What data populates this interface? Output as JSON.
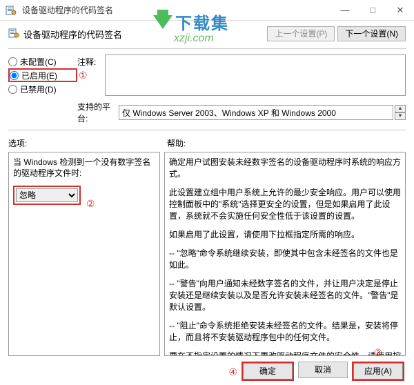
{
  "window": {
    "title": "设备驱动程序的代码签名",
    "minimize": "—",
    "maximize": "□",
    "close": "✕"
  },
  "header": {
    "main_label": "设备驱动程序的代码签名",
    "prev_btn": "上一个设置(P)",
    "next_btn": "下一个设置(N)"
  },
  "radios": {
    "not_configured": "未配置(C)",
    "enabled": "已启用(E)",
    "disabled": "已禁用(D)"
  },
  "labels": {
    "comment": "注释:",
    "platform": "支持的平台:",
    "options": "选项:",
    "help": "帮助:"
  },
  "platform_value": "仅 Windows Server 2003、Windows XP 和 Windows 2000",
  "left_pane": {
    "msg": "当 Windows 检测到一个没有数字签名的驱动程序文件时:",
    "select_value": "忽略"
  },
  "help_text": {
    "p1": "确定用户试图安装未经数字签名的设备驱动程序时系统的响应方式。",
    "p2": "此设置建立组中用户系统上允许的最少安全响应。用户可以使用控制面板中的\"系统\"选择更安全的设置，但是如果启用了此设置，系统就不会实施任何安全性低于该设置的设置。",
    "p3": "如果启用了此设置，请使用下拉框指定所需的响应。",
    "p4": "-- \"忽略\"命令系统继续安装，即使其中包含未经签名的文件也是如此。",
    "p5": "-- \"警告\"向用户通知未经数字签名的文件，并让用户决定是停止安装还是继续安装以及是否允许安装未经签名的文件。\"警告\"是默认设置。",
    "p6": "-- \"阻止\"命令系统拒绝安装未经签名的文件。结果是，安装将停止，而且将不安装驱动程序包中的任何文件。",
    "p7": "要在不指定设置的情况下更改驱动程序文件的安全性，请使用控制面板中的\"系统\"。右键单击\"我的电脑\"，单击\"属性\"，单击\"硬件\"选项卡，然后单击\"驱动程序签名\"按钮。"
  },
  "markers": {
    "m1": "①",
    "m2": "②",
    "m3": "③",
    "m4": "④"
  },
  "footer": {
    "ok": "确定",
    "cancel": "取消",
    "apply": "应用(A)"
  },
  "watermark": {
    "brand": "下载集",
    "url": "xzji.com"
  }
}
